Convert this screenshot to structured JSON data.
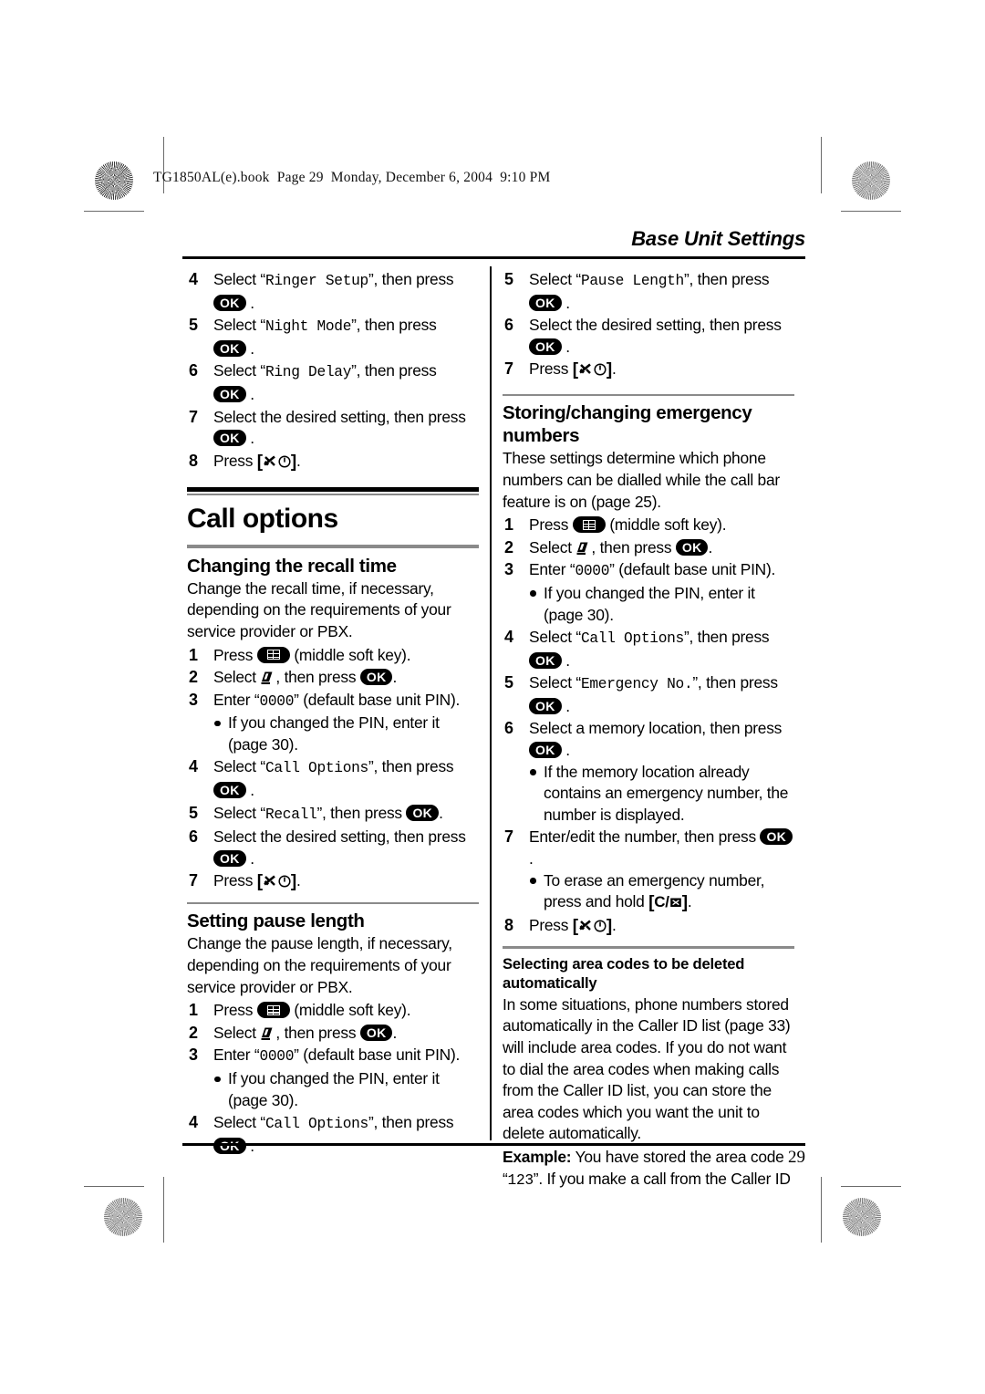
{
  "book_header": "TG1850AL(e).book  Page 29  Monday, December 6, 2004  9:10 PM",
  "running_head": "Base Unit Settings",
  "page_number": "29",
  "keys": {
    "ok": "OK",
    "soft_key_note": "(middle soft key)",
    "soft_key_icon": "middle-soft-key-icon",
    "settings_icon": "settings-icon",
    "offhook_icon": "off-hook-icon",
    "power_icon": "power-icon",
    "erase_icon": "erase-icon",
    "c_label": "C/"
  },
  "left_column": {
    "continued_steps": [
      {
        "num": "4",
        "text_before": "Select “",
        "mono": "Ringer Setup",
        "text_after": "”, then press ",
        "key": "OK",
        "tail": "."
      },
      {
        "num": "5",
        "text_before": "Select “",
        "mono": "Night Mode",
        "text_after": "”, then press ",
        "key": "OK",
        "tail": "."
      },
      {
        "num": "6",
        "text_before": "Select “",
        "mono": "Ring Delay",
        "text_after": "”, then press ",
        "key": "OK",
        "tail": "."
      },
      {
        "num": "7",
        "text_before": "Select the desired setting, then press ",
        "mono": "",
        "text_after": "",
        "key": "OK",
        "tail": "."
      },
      {
        "num": "8",
        "text_before": "Press ",
        "mono": "",
        "text_after": "",
        "key": "OFFHOOK",
        "tail": "."
      }
    ],
    "chapter_title": "Call options",
    "section1": {
      "title": "Changing the recall time",
      "intro": "Change the recall time, if necessary, depending on the requirements of your service provider or PBX.",
      "steps": [
        {
          "num": "1",
          "pre": "Press ",
          "key": "SOFT",
          "post": " (middle soft key)."
        },
        {
          "num": "2",
          "pre": "Select ",
          "key": "SETTINGS",
          "mid": ", then press ",
          "key2": "OK",
          "post": "."
        },
        {
          "num": "3",
          "pre": "Enter “",
          "mono": "0000",
          "post": "” (default base unit PIN)."
        },
        {
          "bullet": "If you changed the PIN, enter it (page 30)."
        },
        {
          "num": "4",
          "pre": "Select “",
          "mono": "Call Options",
          "mid": "”, then press ",
          "key": "OK",
          "post": "."
        },
        {
          "num": "5",
          "pre": "Select “",
          "mono": "Recall",
          "mid": "”, then press ",
          "key": "OK",
          "post": "."
        },
        {
          "num": "6",
          "pre": "Select the desired setting, then press ",
          "key": "OK",
          "post": "."
        },
        {
          "num": "7",
          "pre": "Press ",
          "key": "OFFHOOK",
          "post": "."
        }
      ]
    },
    "section2": {
      "title": "Setting pause length",
      "intro": "Change the pause length, if necessary, depending on the requirements of your service provider or PBX.",
      "steps": [
        {
          "num": "1",
          "pre": "Press ",
          "key": "SOFT",
          "post": " (middle soft key)."
        },
        {
          "num": "2",
          "pre": "Select ",
          "key": "SETTINGS",
          "mid": ", then press ",
          "key2": "OK",
          "post": "."
        },
        {
          "num": "3",
          "pre": "Enter “",
          "mono": "0000",
          "post": "” (default base unit PIN)."
        },
        {
          "bullet": "If you changed the PIN, enter it (page 30)."
        },
        {
          "num": "4",
          "pre": "Select “",
          "mono": "Call Options",
          "mid": "”, then press ",
          "key": "OK",
          "post": "."
        }
      ]
    }
  },
  "right_column": {
    "continued_steps": [
      {
        "num": "5",
        "pre": "Select “",
        "mono": "Pause Length",
        "mid": "”, then press ",
        "key": "OK",
        "post": "."
      },
      {
        "num": "6",
        "pre": "Select the desired setting, then press ",
        "key": "OK",
        "post": "."
      },
      {
        "num": "7",
        "pre": "Press ",
        "key": "OFFHOOK",
        "post": "."
      }
    ],
    "section1": {
      "title": "Storing/changing emergency numbers",
      "intro": "These settings determine which phone numbers can be dialled while the call bar feature is on (page 25).",
      "steps": [
        {
          "num": "1",
          "pre": "Press ",
          "key": "SOFT",
          "post": " (middle soft key)."
        },
        {
          "num": "2",
          "pre": "Select ",
          "key": "SETTINGS",
          "mid": ", then press ",
          "key2": "OK",
          "post": "."
        },
        {
          "num": "3",
          "pre": "Enter “",
          "mono": "0000",
          "post": "” (default base unit PIN)."
        },
        {
          "bullet": "If you changed the PIN, enter it (page 30)."
        },
        {
          "num": "4",
          "pre": "Select “",
          "mono": "Call Options",
          "mid": "”, then press ",
          "key": "OK",
          "post": "."
        },
        {
          "num": "5",
          "pre": "Select “",
          "mono": "Emergency No.",
          "mid": "”, then press ",
          "key": "OK",
          "post": "."
        },
        {
          "num": "6",
          "pre": "Select a memory location, then press ",
          "key": "OK",
          "post": "."
        },
        {
          "bullet": "If the memory location already contains an emergency number, the number is displayed."
        },
        {
          "num": "7",
          "pre": "Enter/edit the number, then press ",
          "key": "OK",
          "post": "."
        },
        {
          "bullet2_pre": "To erase an emergency number, press and hold ",
          "bullet2_key": "C/ERASE",
          "bullet2_post": "."
        },
        {
          "num": "8",
          "pre": "Press ",
          "key": "OFFHOOK",
          "post": "."
        }
      ]
    },
    "subsection": {
      "title": "Selecting area codes to be deleted automatically",
      "body": "In some situations, phone numbers stored automatically in the Caller ID list (page 33) will include area codes. If you do not want to dial the area codes when making calls from the Caller ID list, you can store the area codes which you want the unit to delete automatically.",
      "example_label": "Example:",
      "example_text_1": " You have stored the area code “",
      "example_mono": "123",
      "example_text_2": "”. If you make a call from the Caller ID"
    }
  }
}
